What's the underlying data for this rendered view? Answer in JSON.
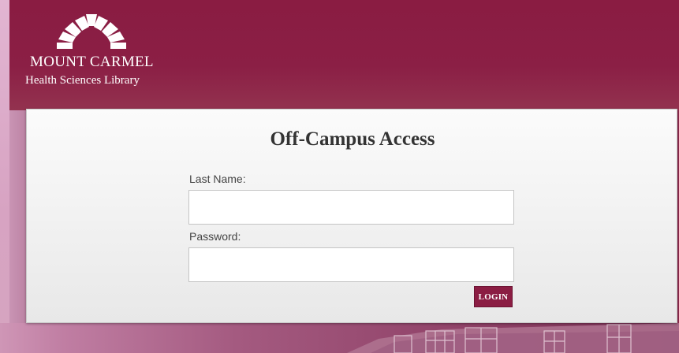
{
  "brand": {
    "line1": "MOUNT CARMEL",
    "line2": "Health Sciences Library",
    "logo_icon": "arch-logo-icon"
  },
  "login_form": {
    "title": "Off-Campus Access",
    "last_name_label": "Last Name:",
    "last_name_value": "",
    "password_label": "Password:",
    "password_value": "",
    "login_button_label": "LOGIN"
  },
  "colors": {
    "brand_maroon": "#8b1d43",
    "panel_background": "#f2f2f2",
    "title_text": "#333333"
  }
}
